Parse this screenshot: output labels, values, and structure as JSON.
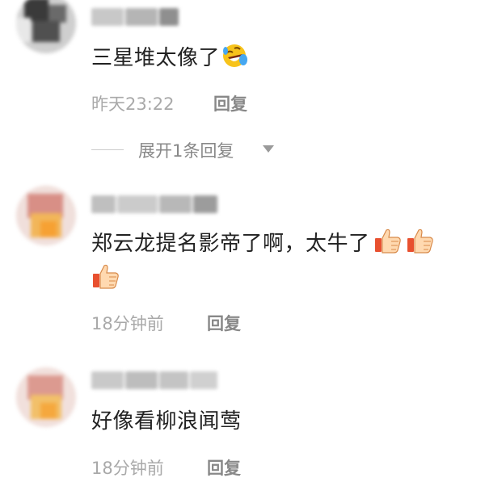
{
  "comments": [
    {
      "text": "三星堆太像了",
      "emoji": "rofl-emoji",
      "time": "昨天23:22",
      "reply_label": "回复",
      "expand_label": "展开1条回复"
    },
    {
      "text": "郑云龙提名影帝了啊，太牛了",
      "emoji": "thumbs-up-emoji",
      "time": "18分钟前",
      "reply_label": "回复"
    },
    {
      "text": "好像看柳浪闻莺",
      "time": "18分钟前",
      "reply_label": "回复"
    }
  ],
  "colors": {
    "text": "#222222",
    "meta": "#a9a9a9",
    "reply": "#888888",
    "background": "#ffffff"
  }
}
